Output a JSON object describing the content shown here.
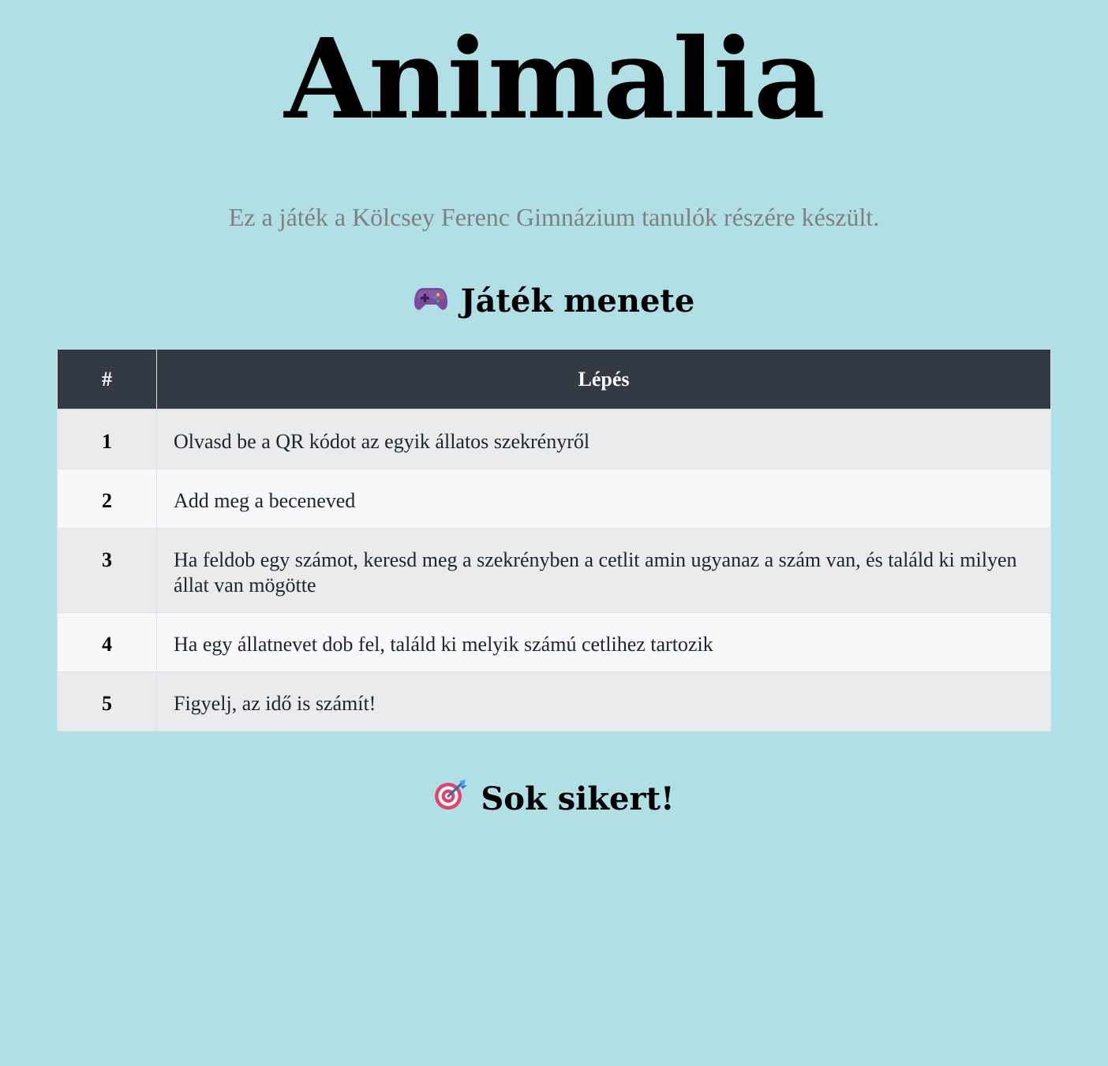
{
  "header": {
    "title": "Animalia",
    "subtitle": "Ez a játék a Kölcsey Ferenc Gimnázium tanulók részére készült."
  },
  "rules_section": {
    "icon": "game-controller-icon",
    "title": "Játék menete"
  },
  "steps_table": {
    "columns": [
      "#",
      "Lépés"
    ],
    "rows": [
      {
        "num": "1",
        "text": "Olvasd be a QR kódot az egyik állatos szekrényről"
      },
      {
        "num": "2",
        "text": "Add meg a beceneved"
      },
      {
        "num": "3",
        "text": "Ha feldob egy számot, keresd meg a szekrényben a cetlit amin ugyanaz a szám van, és találd ki milyen állat van mögötte"
      },
      {
        "num": "4",
        "text": "Ha egy állatnevet dob fel, találd ki melyik számú cetlihez tartozik"
      },
      {
        "num": "5",
        "text": "Figyelj, az idő is számít!"
      }
    ]
  },
  "footer_section": {
    "icon": "bullseye-dart-icon",
    "title": "Sok sikert!"
  },
  "colors": {
    "background": "#b0dfe5",
    "table_header": "#343a44",
    "row_odd": "#e9ebed",
    "row_even": "#f7f8fa",
    "subtitle_text": "#808080"
  }
}
